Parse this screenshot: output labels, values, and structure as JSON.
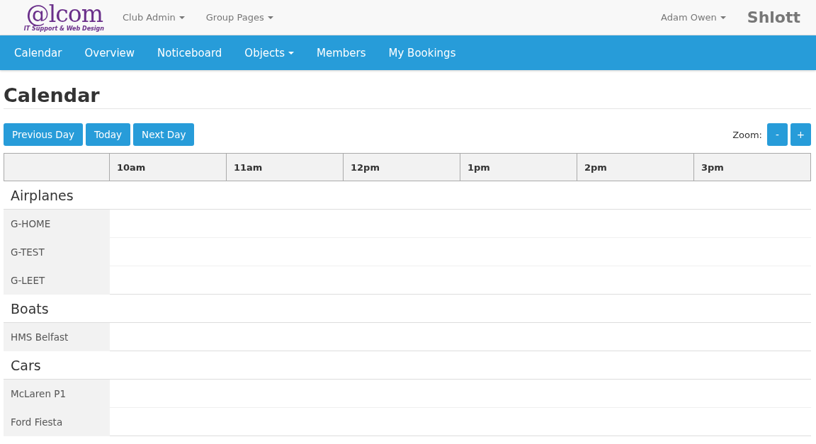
{
  "brand": {
    "logo": "@lcom",
    "tagline": "IT Support & Web Design"
  },
  "top_menu": [
    {
      "label": "Club Admin",
      "dropdown": true
    },
    {
      "label": "Group Pages",
      "dropdown": true
    }
  ],
  "user_menu": {
    "label": "Adam Owen",
    "dropdown": true
  },
  "app_name": "Shlott",
  "nav": [
    {
      "label": "Calendar",
      "dropdown": false
    },
    {
      "label": "Overview",
      "dropdown": false
    },
    {
      "label": "Noticeboard",
      "dropdown": false
    },
    {
      "label": "Objects",
      "dropdown": true
    },
    {
      "label": "Members",
      "dropdown": false
    },
    {
      "label": "My Bookings",
      "dropdown": false
    }
  ],
  "page_title": "Calendar",
  "day_buttons": [
    "Previous Day",
    "Today",
    "Next Day"
  ],
  "zoom": {
    "label": "Zoom:",
    "buttons": [
      "-",
      "+"
    ]
  },
  "table": {
    "columns": [
      "10am",
      "11am",
      "12pm",
      "1pm",
      "2pm",
      "3pm"
    ],
    "groups": [
      {
        "name": "Airplanes",
        "rows": [
          "G-HOME",
          "G-TEST",
          "G-LEET"
        ]
      },
      {
        "name": "Boats",
        "rows": [
          "HMS Belfast"
        ]
      },
      {
        "name": "Cars",
        "rows": [
          "McLaren P1",
          "Ford Fiesta"
        ]
      }
    ]
  }
}
